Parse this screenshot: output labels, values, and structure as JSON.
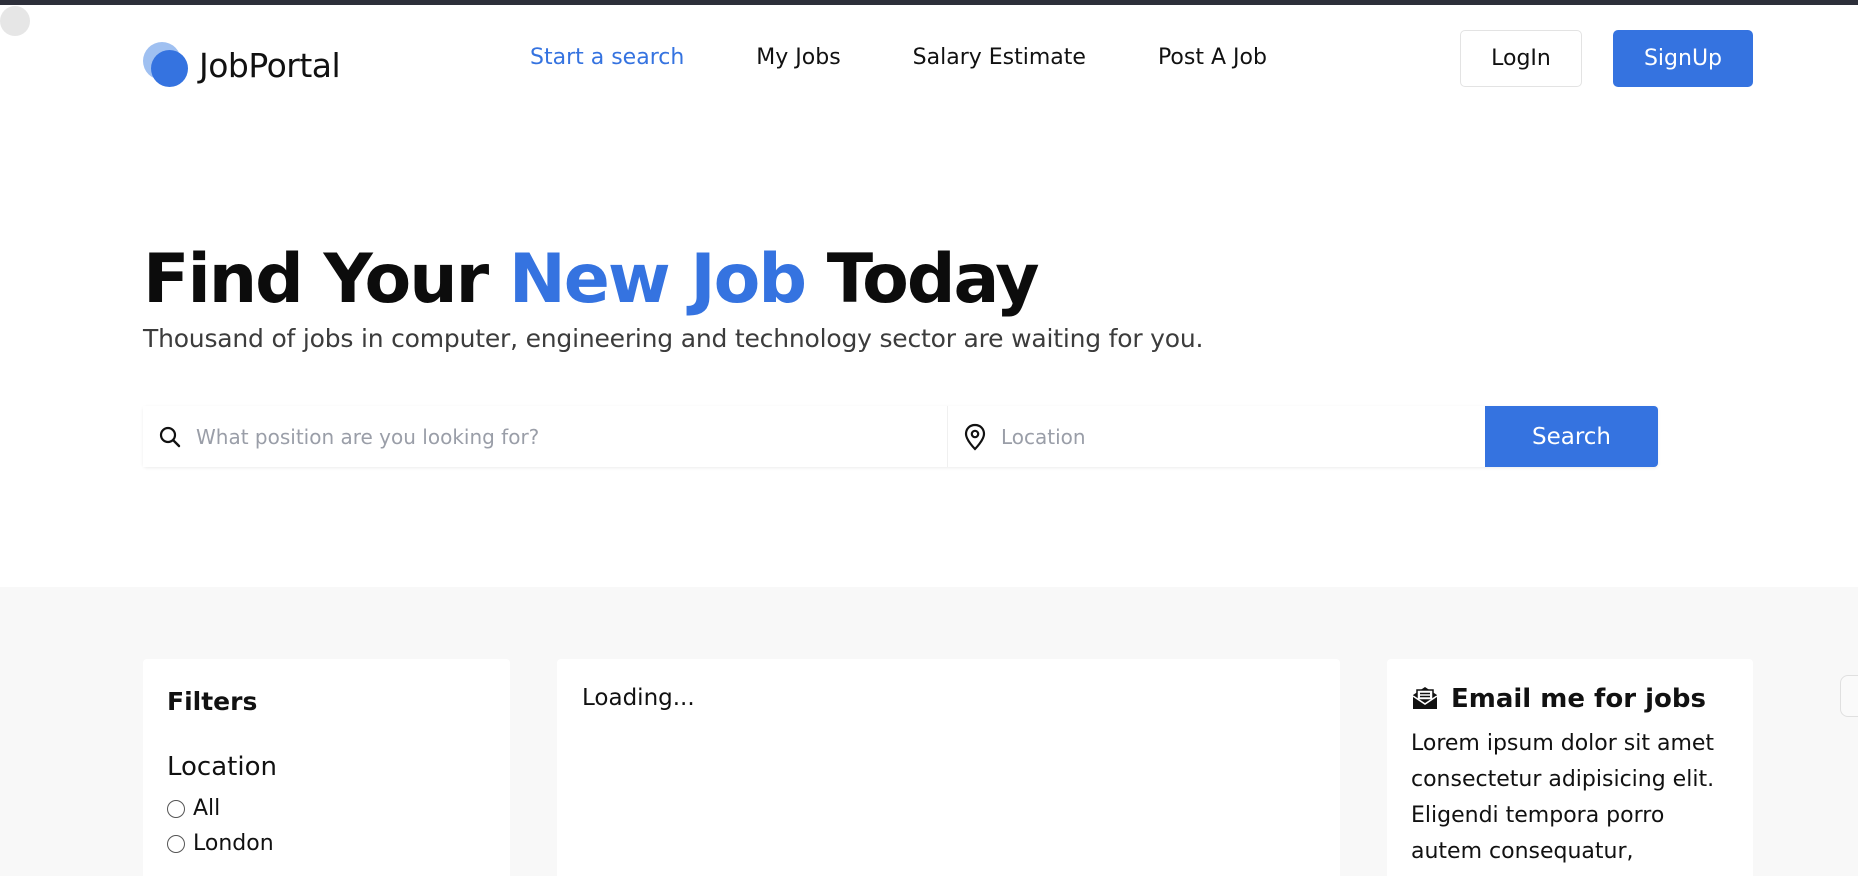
{
  "brand": {
    "name": "JobPortal",
    "accent_color": "#3573e0"
  },
  "nav": {
    "items": [
      {
        "label": "Start a search",
        "active": true
      },
      {
        "label": "My Jobs",
        "active": false
      },
      {
        "label": "Salary Estimate",
        "active": false
      },
      {
        "label": "Post A Job",
        "active": false
      }
    ]
  },
  "auth": {
    "login_label": "LogIn",
    "signup_label": "SignUp"
  },
  "hero": {
    "title_prefix": "Find Your ",
    "title_accent": "New Job",
    "title_suffix": " Today",
    "subtitle": "Thousand of jobs in computer, engineering and technology sector are waiting for you."
  },
  "search": {
    "position_placeholder": "What position are you looking for?",
    "location_placeholder": "Location",
    "button_label": "Search",
    "position_icon": "search-icon",
    "location_icon": "map-pin-icon"
  },
  "filters": {
    "title": "Filters",
    "location_heading": "Location",
    "options": [
      "All",
      "London"
    ]
  },
  "results": {
    "status": "Loading..."
  },
  "email_alert": {
    "icon": "envelope-open-icon",
    "title": "Email me for jobs",
    "body": "Lorem ipsum dolor sit amet consectetur adipisicing elit. Eligendi tempora porro autem consequatur,"
  }
}
